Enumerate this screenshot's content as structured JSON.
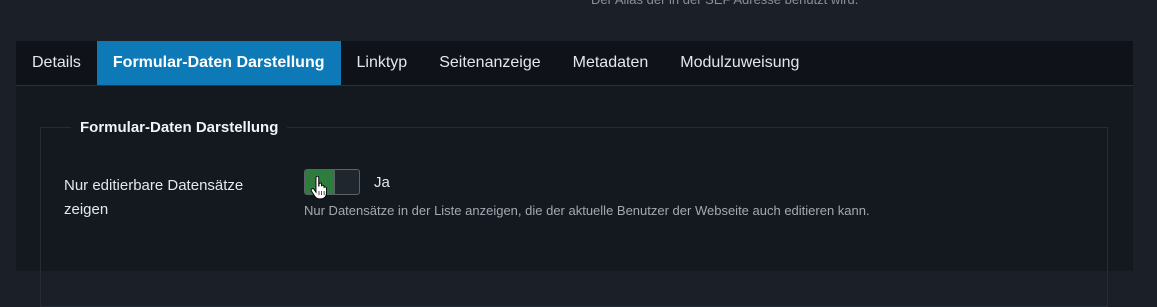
{
  "top_hint": "Der Alias der in der SEF Adresse benutzt wird.",
  "tabs": [
    {
      "label": "Details",
      "active": false
    },
    {
      "label": "Formular-Daten Darstellung",
      "active": true
    },
    {
      "label": "Linktyp",
      "active": false
    },
    {
      "label": "Seitenanzeige",
      "active": false
    },
    {
      "label": "Metadaten",
      "active": false
    },
    {
      "label": "Modulzuweisung",
      "active": false
    }
  ],
  "section": {
    "legend": "Formular-Daten Darstellung",
    "field": {
      "label": "Nur editierbare Datensätze zeigen",
      "value": "Ja",
      "enabled": true,
      "help": "Nur Datensätze in der Liste anzeigen, die der aktuelle Benutzer der Webseite auch editieren kann."
    }
  },
  "colors": {
    "active_tab": "#0d79b6",
    "switch_on": "#2f7d3d",
    "background": "#1b1f27"
  },
  "icons": {
    "cursor": "hand-pointer-icon"
  }
}
